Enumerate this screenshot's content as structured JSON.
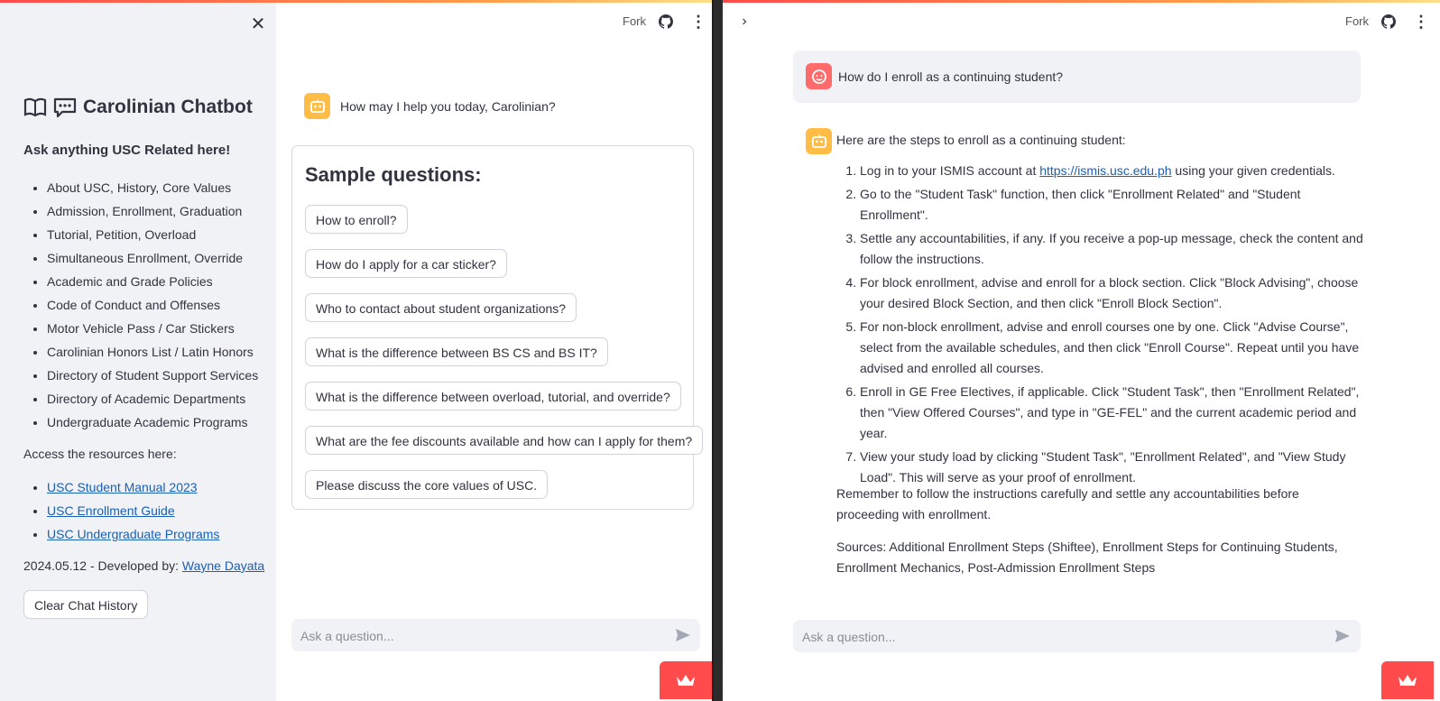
{
  "header": {
    "fork_label": "Fork"
  },
  "sidebar": {
    "title": "Carolinian Chatbot",
    "subtitle": "Ask anything USC Related here!",
    "topics": [
      "About USC, History, Core Values",
      "Admission, Enrollment, Graduation",
      "Tutorial, Petition, Overload",
      "Simultaneous Enrollment, Override",
      "Academic and Grade Policies",
      "Code of Conduct and Offenses",
      "Motor Vehicle Pass / Car Stickers",
      "Carolinian Honors List / Latin Honors",
      "Directory of Student Support Services",
      "Directory of Academic Departments",
      "Undergraduate Academic Programs"
    ],
    "access_label": "Access the resources here:",
    "resources": [
      "USC Student Manual 2023",
      "USC Enrollment Guide",
      "USC Undergraduate Programs"
    ],
    "dev_prefix": "2024.05.12 - Developed by:",
    "dev_name": "Wayne Dayata",
    "clear_button": "Clear Chat History"
  },
  "left_chat": {
    "greeting": "How may I help you today, Carolinian?",
    "sample_title": "Sample questions:",
    "sample_questions": [
      "How to enroll?",
      "How do I apply for a car sticker?",
      "Who to contact about student organizations?",
      "What is the difference between BS CS and BS IT?",
      "What is the difference between overload, tutorial, and override?",
      "What are the fee discounts available and how can I apply for them?",
      "Please discuss the core values of USC."
    ],
    "input_placeholder": "Ask a question..."
  },
  "right_chat": {
    "user_question": "How do I enroll as a continuing student?",
    "intro": "Here are the steps to enroll as a continuing student:",
    "step1_prefix": "Log in to your ISMIS account at",
    "step1_link": "https://ismis.usc.edu.ph",
    "step1_suffix": "using your given credentials.",
    "steps": [
      "Go to the \"Student Task\" function, then click \"Enrollment Related\" and \"Student Enrollment\".",
      "Settle any accountabilities, if any. If you receive a pop-up message, check the content and follow the instructions.",
      "For block enrollment, advise and enroll for a block section. Click \"Block Advising\", choose your desired Block Section, and then click \"Enroll Block Section\".",
      "For non-block enrollment, advise and enroll courses one by one. Click \"Advise Course\", select from the available schedules, and then click \"Enroll Course\". Repeat until you have advised and enrolled all courses.",
      "Enroll in GE Free Electives, if applicable. Click \"Student Task\", then \"Enrollment Related\", then \"View Offered Courses\", and type in \"GE-FEL\" and the current academic period and year.",
      "View your study load by clicking \"Student Task\", \"Enrollment Related\", and \"View Study Load\". This will serve as your proof of enrollment."
    ],
    "reminder": "Remember to follow the instructions carefully and settle any accountabilities before proceeding with enrollment.",
    "sources": "Sources: Additional Enrollment Steps (Shiftee), Enrollment Steps for Continuing Students, Enrollment Mechanics, Post-Admission Enrollment Steps",
    "input_placeholder": "Ask a question..."
  },
  "colors": {
    "accent": "#ff4b4b",
    "bot_avatar": "#ffbd45",
    "user_avatar": "#ff6b6b",
    "sidebar_bg": "#f0f2f6",
    "link": "#1a5fb4"
  },
  "icons": [
    "close-icon",
    "book-icon",
    "chat-icon",
    "github-icon",
    "kebab-menu-icon",
    "bot-avatar-icon",
    "user-avatar-icon",
    "send-icon",
    "streamlit-crown-icon",
    "chevron-right-icon"
  ]
}
